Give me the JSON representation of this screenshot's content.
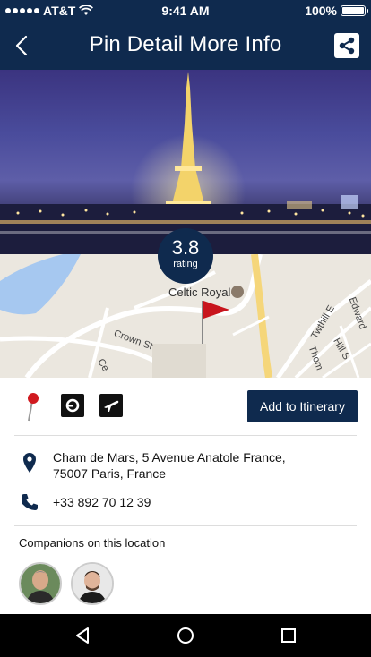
{
  "status_bar": {
    "carrier": "AT&T",
    "time": "9:41 AM",
    "battery": "100%"
  },
  "header": {
    "title": "Pin Detail More Info"
  },
  "rating": {
    "value": "3.8",
    "label": "rating"
  },
  "map": {
    "poi_name": "Celtic Royal",
    "streets": [
      "Crown St",
      "Twthill E",
      "Edward",
      "Hill S",
      "Thom",
      "Ce"
    ]
  },
  "actions": {
    "add_to_itinerary": "Add to Itinerary",
    "icons": [
      "pin-icon",
      "uber-icon",
      "flight-icon"
    ]
  },
  "location": {
    "address_line1": "Cham de Mars, 5 Avenue Anatole France,",
    "address_line2": "75007 Paris, France",
    "phone": "+33 892 70 12 39"
  },
  "companions": {
    "title": "Companions on this location",
    "count": 2
  },
  "colors": {
    "primary": "#0f2a4e",
    "accent_red": "#d0191f",
    "map_bg": "#ebe7df",
    "water": "#a6c8f0"
  }
}
